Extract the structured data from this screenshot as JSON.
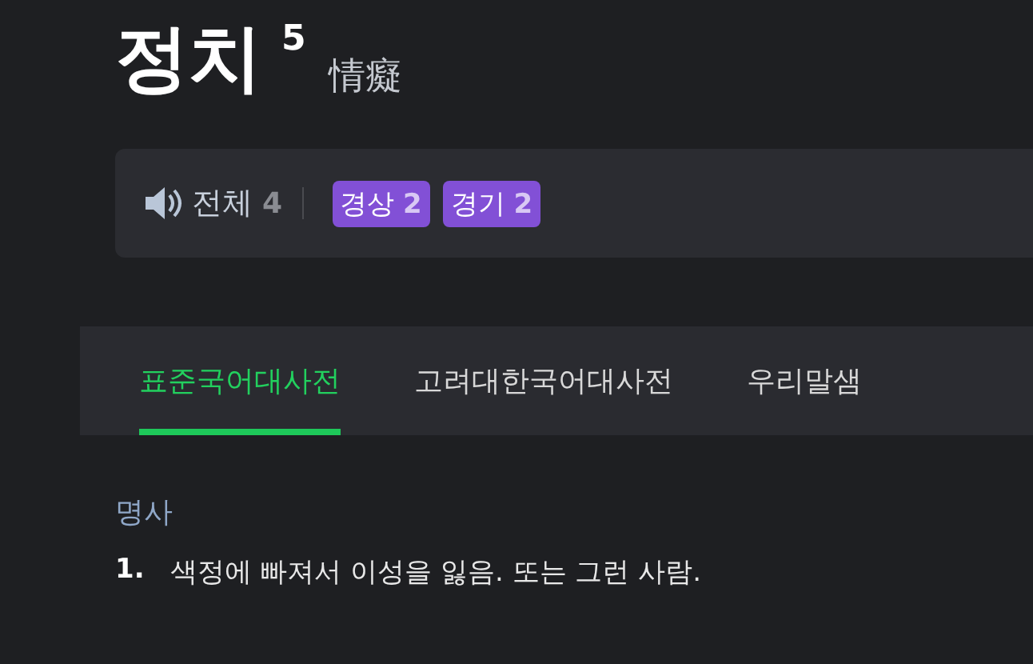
{
  "headword": {
    "text": "정치",
    "homonym": "5",
    "hanja": "情癡"
  },
  "pronunciation": {
    "label": "전체",
    "count": "4",
    "tags": [
      {
        "label": "경상",
        "count": "2"
      },
      {
        "label": "경기",
        "count": "2"
      }
    ]
  },
  "tabs": [
    {
      "label": "표준국어대사전",
      "selected": true
    },
    {
      "label": "고려대한국어대사전",
      "selected": false
    },
    {
      "label": "우리말샘",
      "selected": false
    }
  ],
  "pos": "명사",
  "definitions": [
    {
      "number": "1.",
      "text": "색정에 빠져서 이성을 잃음. 또는 그런 사람."
    }
  ]
}
